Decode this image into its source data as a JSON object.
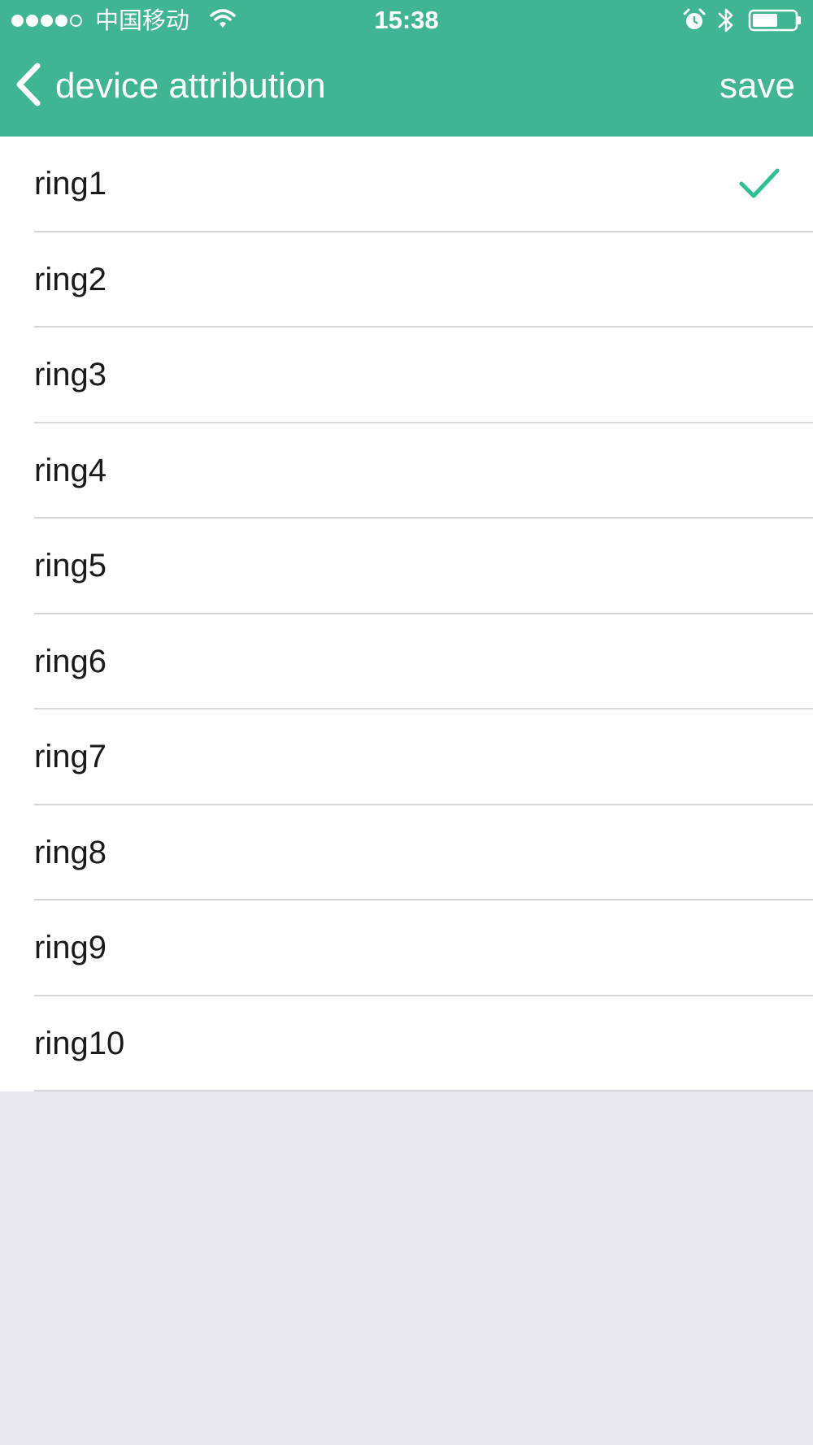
{
  "status_bar": {
    "carrier": "中国移动",
    "time": "15:38",
    "signal_icon": "signal-dots-icon",
    "wifi_icon": "wifi-icon",
    "alarm_icon": "alarm-icon",
    "bluetooth_icon": "bluetooth-icon",
    "battery_icon": "battery-icon"
  },
  "nav": {
    "back_icon": "chevron-left-icon",
    "title": "device attribution",
    "save_label": "save"
  },
  "list": {
    "items": [
      {
        "label": "ring1",
        "selected": true
      },
      {
        "label": "ring2",
        "selected": false
      },
      {
        "label": "ring3",
        "selected": false
      },
      {
        "label": "ring4",
        "selected": false
      },
      {
        "label": "ring5",
        "selected": false
      },
      {
        "label": "ring6",
        "selected": false
      },
      {
        "label": "ring7",
        "selected": false
      },
      {
        "label": "ring8",
        "selected": false
      },
      {
        "label": "ring9",
        "selected": false
      },
      {
        "label": "ring10",
        "selected": false
      }
    ],
    "check_icon": "checkmark-icon"
  },
  "colors": {
    "header_bg": "#40b593",
    "check": "#2fbf97",
    "page_bg": "#e9e8f1",
    "separator": "#d6d6d6"
  }
}
